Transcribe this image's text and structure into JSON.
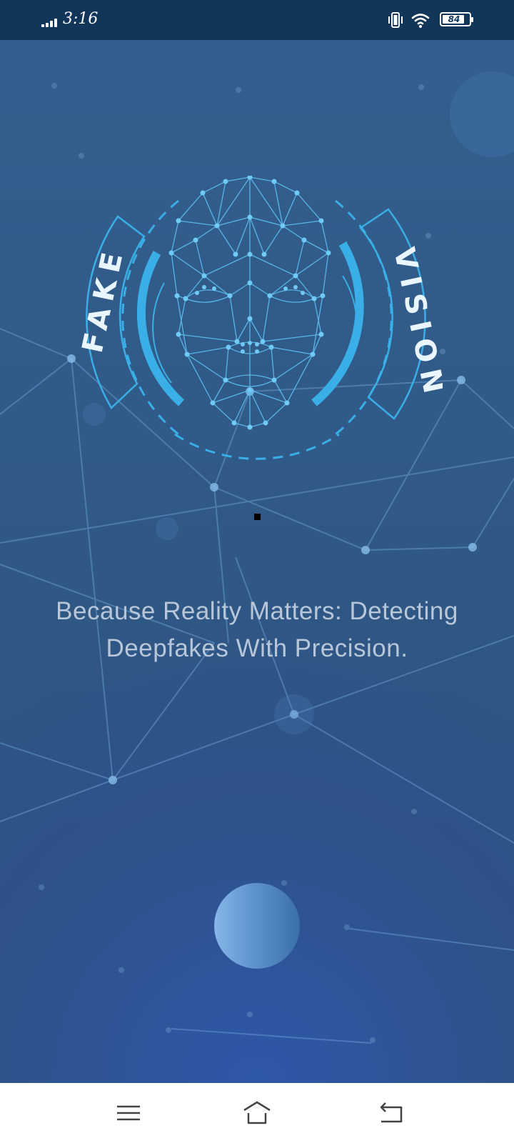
{
  "status_bar": {
    "time": "3:16",
    "battery_level": "84",
    "icons": [
      "signal-icon",
      "vibrate-icon",
      "wifi-icon",
      "battery-icon"
    ]
  },
  "logo": {
    "left_text": "FAKE",
    "right_text": "VISION",
    "accent_color": "#2fb0ee"
  },
  "tagline": {
    "line1": "Because Reality Matters: Detecting",
    "line2": "Deepfakes With Precision."
  },
  "nav_bar": {
    "icons": [
      "menu-icon",
      "home-icon",
      "back-icon"
    ]
  }
}
